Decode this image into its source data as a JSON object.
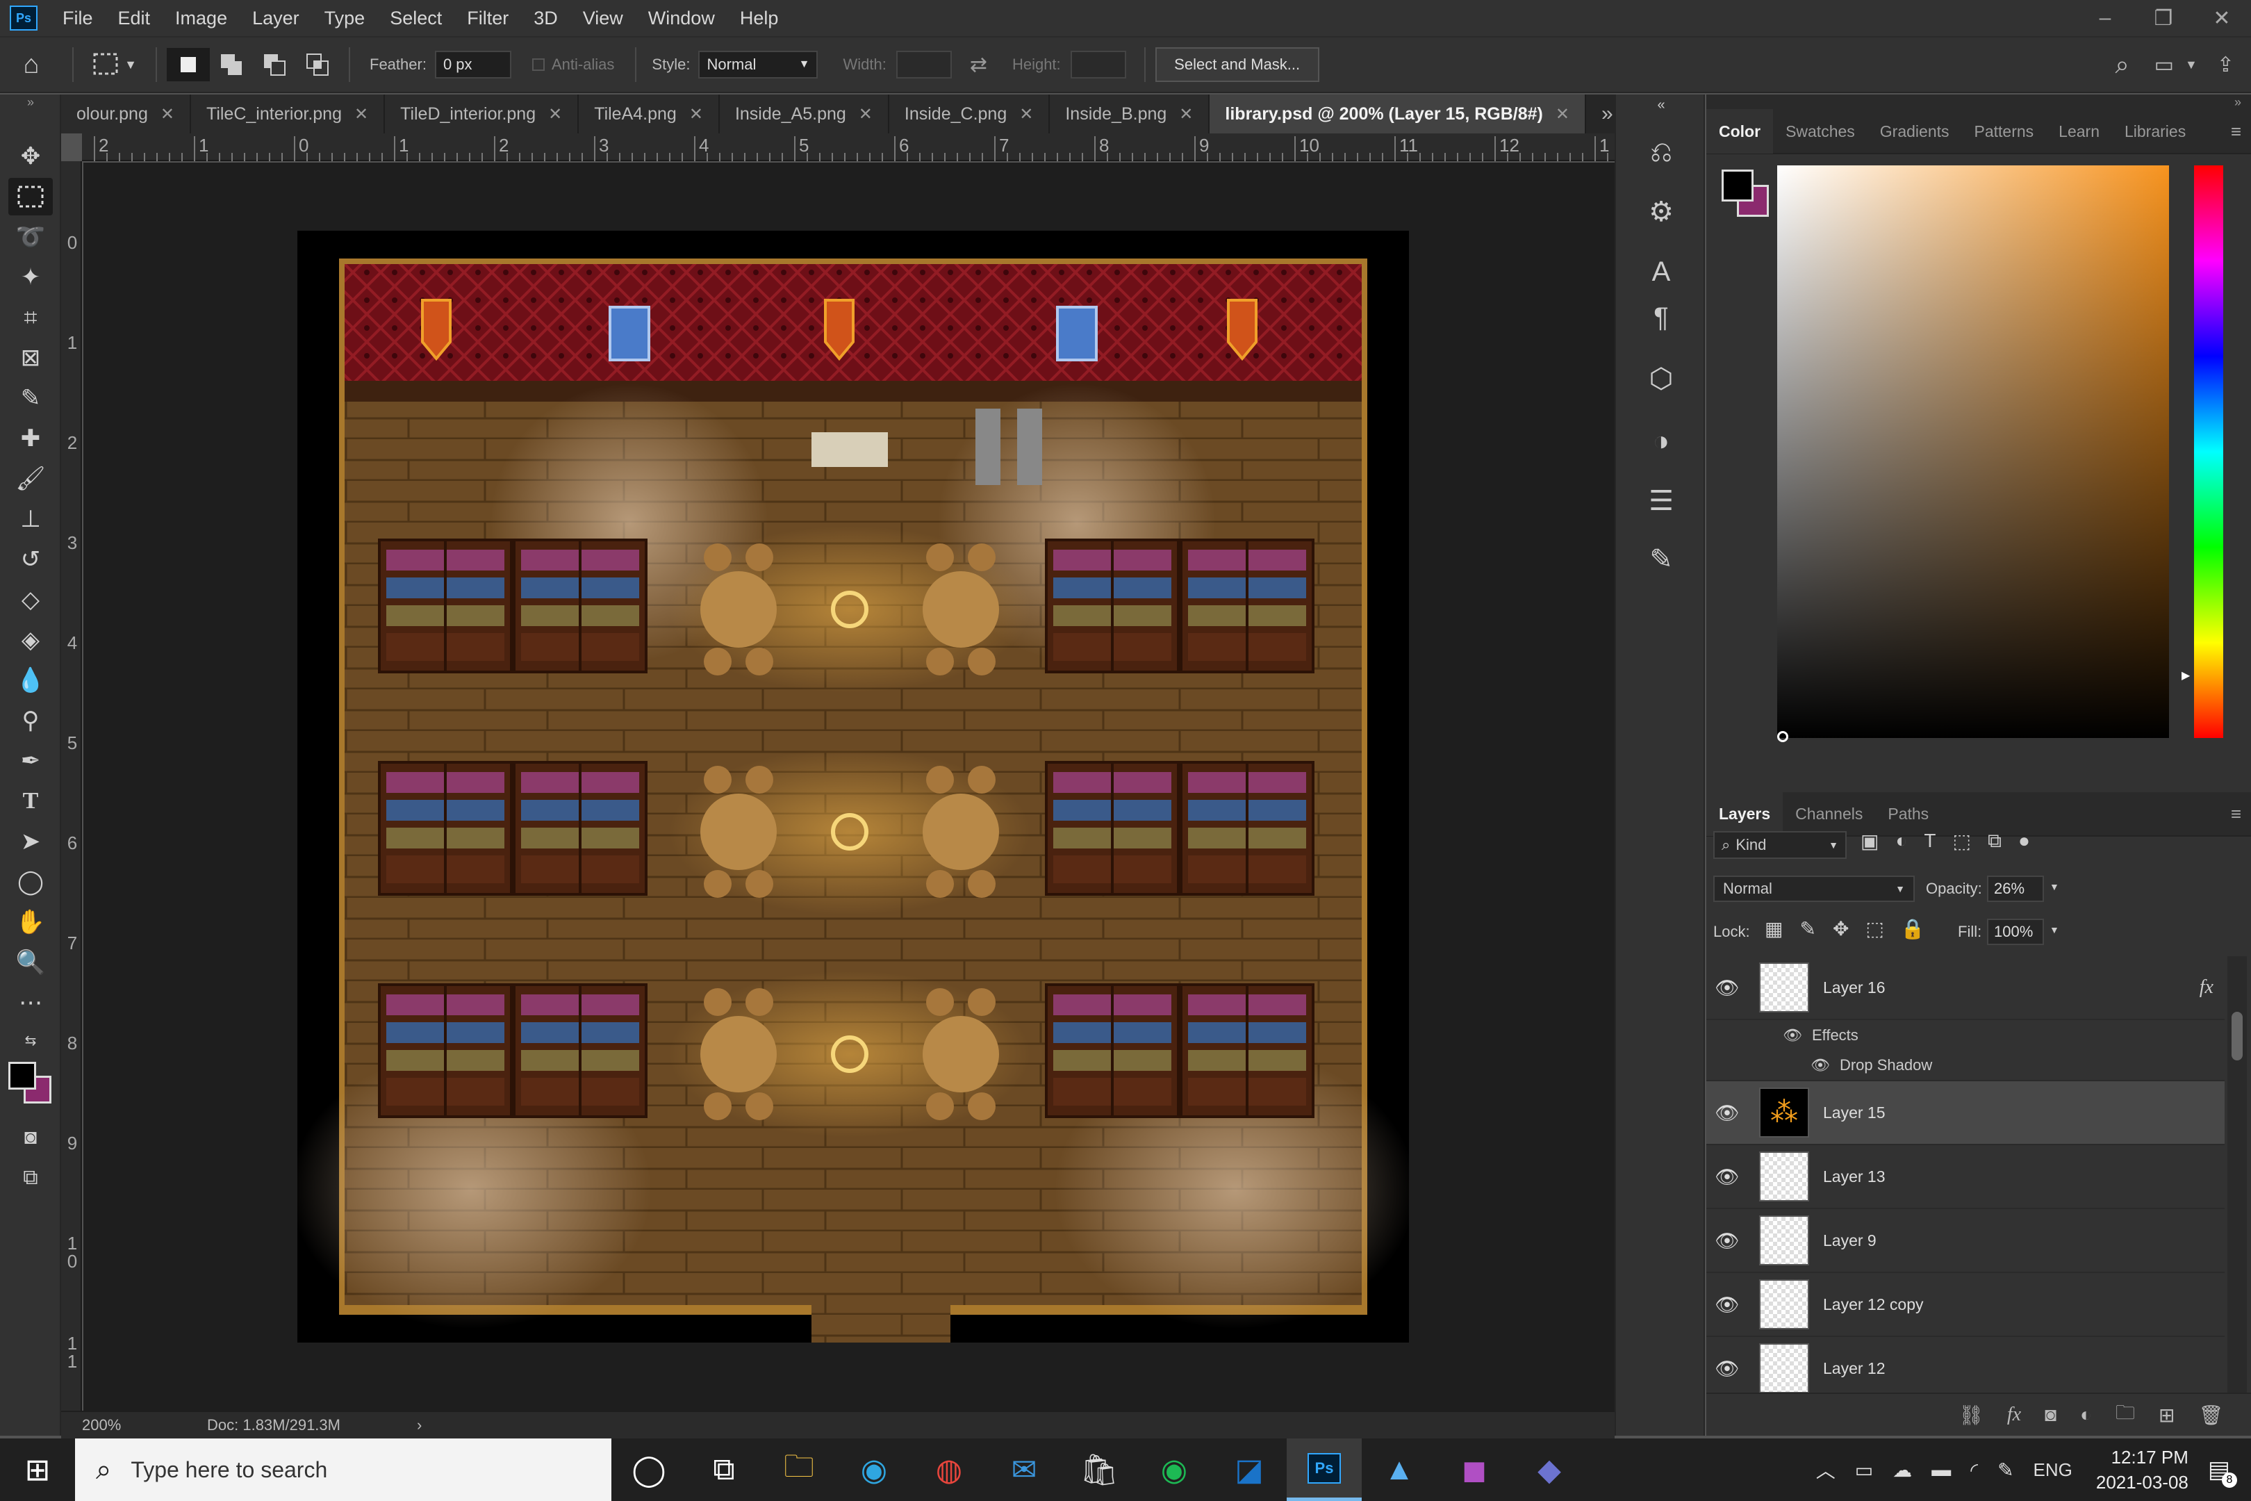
{
  "app": {
    "logo": "Ps"
  },
  "menu": [
    "File",
    "Edit",
    "Image",
    "Layer",
    "Type",
    "Select",
    "Filter",
    "3D",
    "View",
    "Window",
    "Help"
  ],
  "window_controls": {
    "minimize": "–",
    "restore": "❐",
    "close": "✕"
  },
  "options": {
    "feather_label": "Feather:",
    "feather_value": "0 px",
    "antialias_label": "Anti-alias",
    "style_label": "Style:",
    "style_value": "Normal",
    "width_label": "Width:",
    "height_label": "Height:",
    "select_mask": "Select and Mask..."
  },
  "tabs": [
    {
      "label": "olour.png"
    },
    {
      "label": "TileC_interior.png"
    },
    {
      "label": "TileD_interior.png"
    },
    {
      "label": "TileA4.png"
    },
    {
      "label": "Inside_A5.png"
    },
    {
      "label": "Inside_C.png"
    },
    {
      "label": "Inside_B.png"
    },
    {
      "label": "library.psd @ 200% (Layer 15, RGB/8#)"
    }
  ],
  "ruler_top": [
    "2",
    "1",
    "0",
    "1",
    "2",
    "3",
    "4",
    "5",
    "6",
    "7",
    "8",
    "9",
    "10",
    "11",
    "12",
    "1"
  ],
  "ruler_left": [
    "0",
    "1",
    "2",
    "3",
    "4",
    "5",
    "6",
    "7",
    "8",
    "9",
    "1 0",
    "1 1"
  ],
  "status": {
    "zoom": "200%",
    "doc": "Doc: 1.83M/291.3M",
    "arrow": "›"
  },
  "color_panel": {
    "tabs": [
      "Color",
      "Swatches",
      "Gradients",
      "Patterns",
      "Learn",
      "Libraries"
    ],
    "fg_color": "#000000",
    "bg_color": "#8b2a6e",
    "hue_color": "#f7931e"
  },
  "layers_panel": {
    "tabs": [
      "Layers",
      "Channels",
      "Paths"
    ],
    "filter_kind": "Kind",
    "blend_mode": "Normal",
    "opacity_label": "Opacity:",
    "opacity_value": "26%",
    "lock_label": "Lock:",
    "fill_label": "Fill:",
    "fill_value": "100%",
    "layers": [
      {
        "name": "Layer 16",
        "fx": "fx"
      },
      {
        "name": "Layer 15"
      },
      {
        "name": "Layer 13"
      },
      {
        "name": "Layer 9"
      },
      {
        "name": "Layer 12 copy"
      },
      {
        "name": "Layer 12"
      }
    ],
    "effects_label": "Effects",
    "drop_shadow_label": "Drop Shadow"
  },
  "taskbar": {
    "search_placeholder": "Type here to search",
    "lang": "ENG",
    "time": "12:17 PM",
    "date": "2021-03-08",
    "notif_count": "8"
  }
}
